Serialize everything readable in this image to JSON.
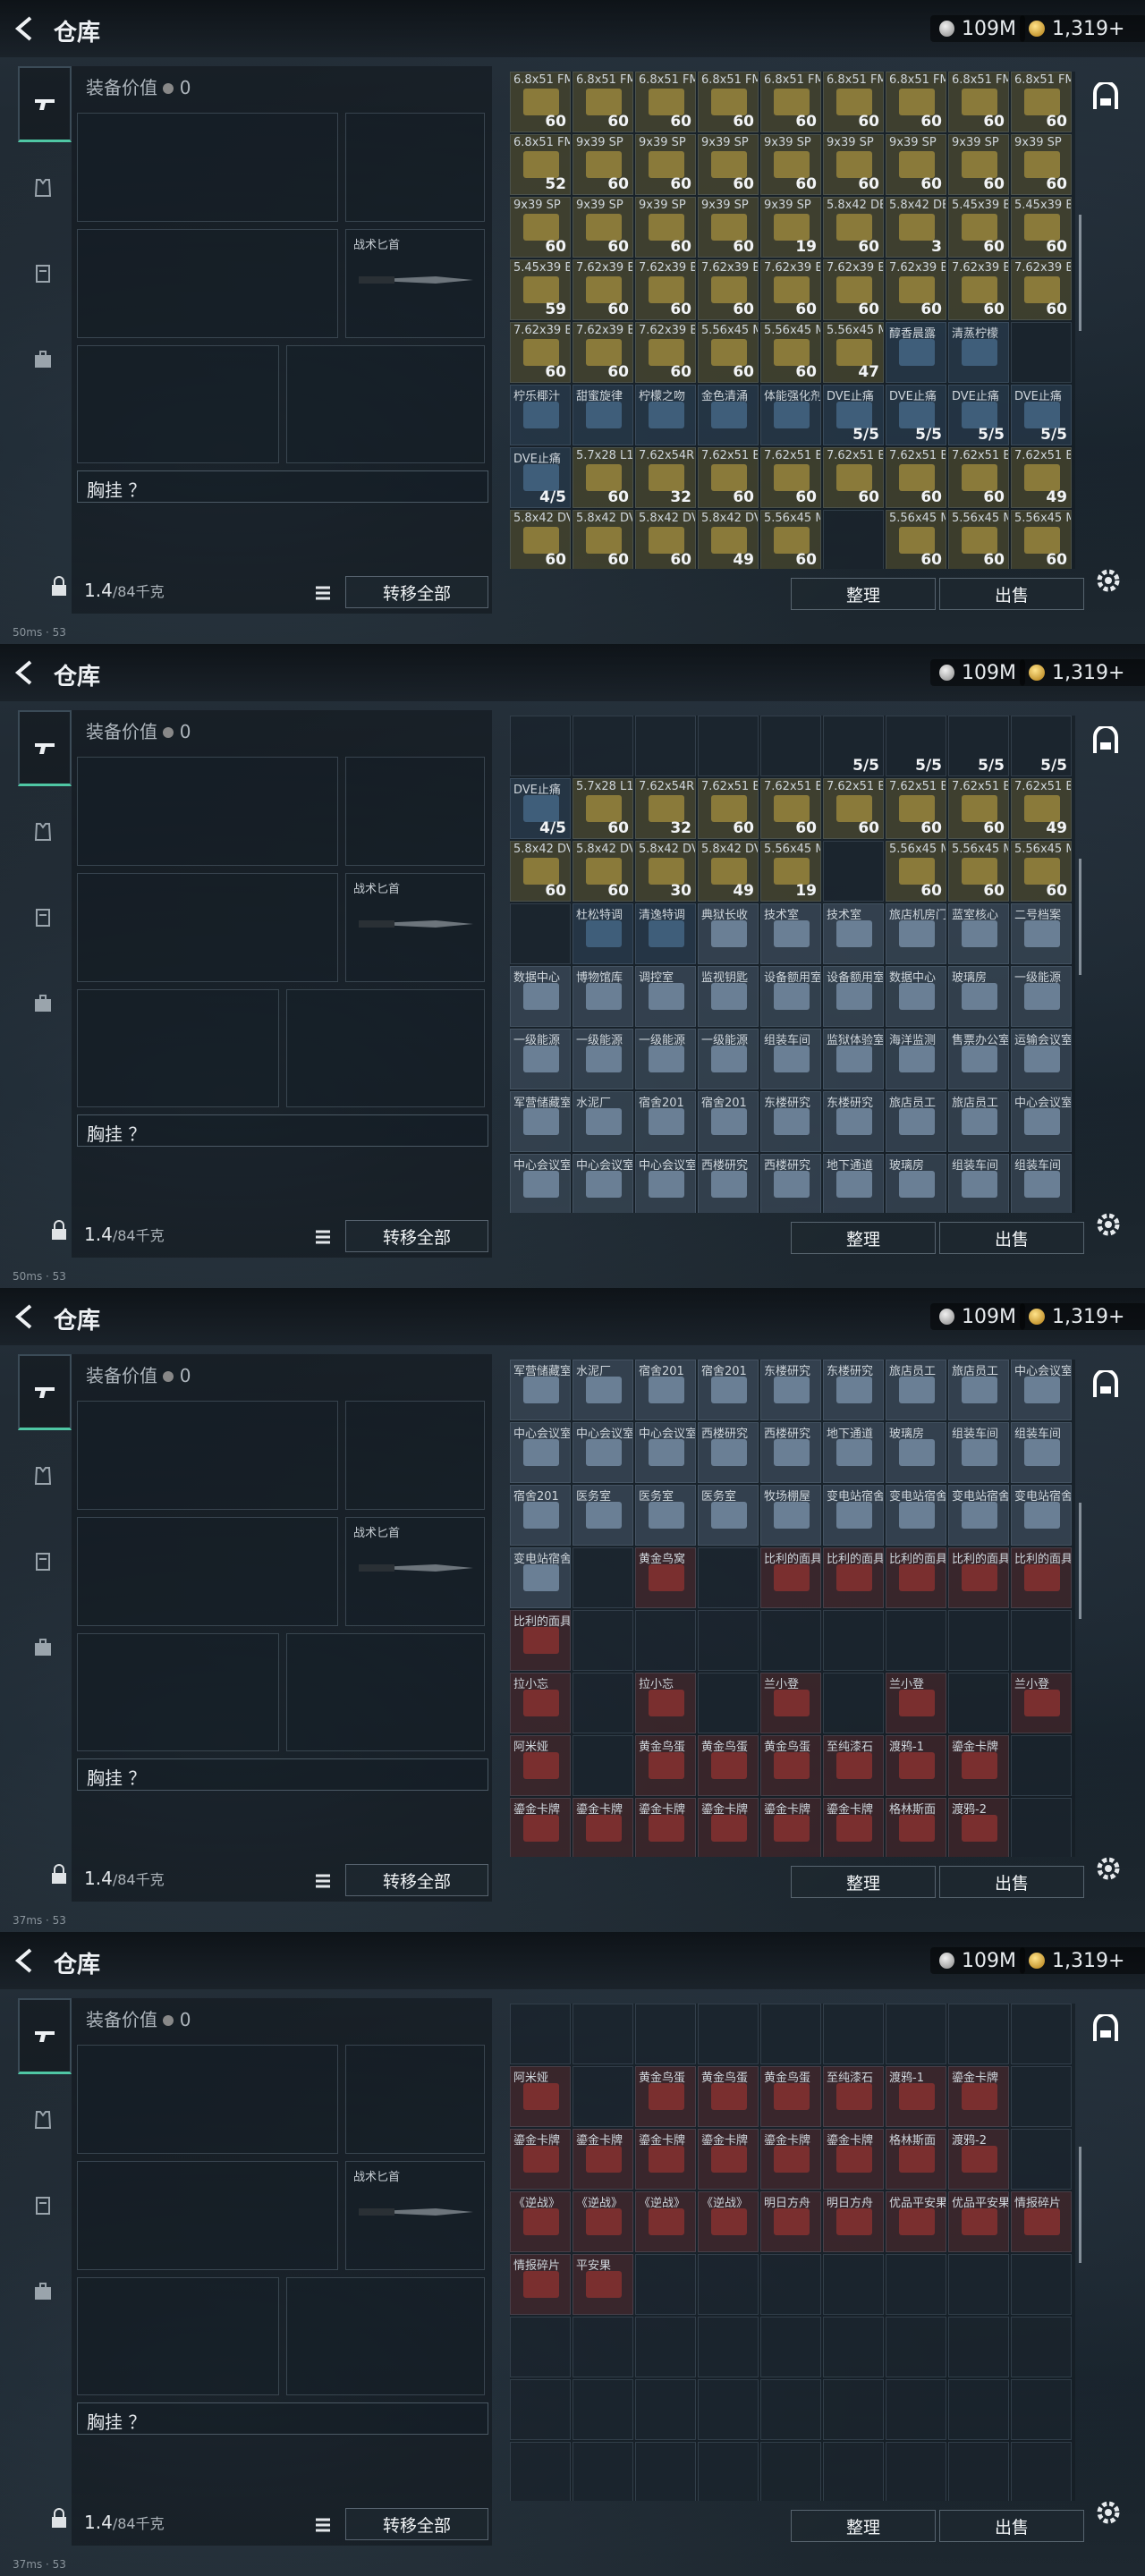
{
  "topbar": {
    "title": "仓库",
    "silver": "109M",
    "gold": "1,319+"
  },
  "equip": {
    "value_label": "装备价值",
    "value": "0",
    "knife_label": "战术匕首",
    "chest_label": "胸挂 ？",
    "weight_current": "1.4",
    "weight_max": "/84千克",
    "transfer_label": "转移全部"
  },
  "actions": {
    "sort": "整理",
    "sell": "出售"
  },
  "status": {
    "ping": "50ms",
    "ping2": "37ms",
    "fps": "53"
  },
  "screens": [
    {
      "rows": [
        [
          [
            "6.8x51 FM",
            "60"
          ],
          [
            "6.8x51 FM",
            "60"
          ],
          [
            "6.8x51 FM",
            "60"
          ],
          [
            "6.8x51 FM",
            "60"
          ],
          [
            "6.8x51 FM",
            "60"
          ],
          [
            "6.8x51 FM",
            "60"
          ],
          [
            "6.8x51 FM",
            "60"
          ],
          [
            "6.8x51 FM",
            "60"
          ],
          [
            "6.8x51 FM",
            "60"
          ]
        ],
        [
          [
            "6.8x51 FM",
            "52"
          ],
          [
            "9x39 SP",
            "60"
          ],
          [
            "9x39 SP",
            "60"
          ],
          [
            "9x39 SP",
            "60"
          ],
          [
            "9x39 SP",
            "60"
          ],
          [
            "9x39 SP",
            "60"
          ],
          [
            "9x39 SP",
            "60"
          ],
          [
            "9x39 SP",
            "60"
          ],
          [
            "9x39 SP",
            "60"
          ]
        ],
        [
          [
            "9x39 SP",
            "60"
          ],
          [
            "9x39 SP",
            "60"
          ],
          [
            "9x39 SP",
            "60"
          ],
          [
            "9x39 SP",
            "60"
          ],
          [
            "9x39 SP",
            "19"
          ],
          [
            "5.8x42 DBP",
            "60"
          ],
          [
            "5.8x42 DBP",
            "3"
          ],
          [
            "5.45x39 BP",
            "60"
          ],
          [
            "5.45x39 BP",
            "60"
          ]
        ],
        [
          [
            "5.45x39 BP",
            "59"
          ],
          [
            "7.62x39 BP",
            "60"
          ],
          [
            "7.62x39 BP",
            "60"
          ],
          [
            "7.62x39 BP",
            "60"
          ],
          [
            "7.62x39 BP",
            "60"
          ],
          [
            "7.62x39 BP",
            "60"
          ],
          [
            "7.62x39 BP",
            "60"
          ],
          [
            "7.62x39 BP",
            "60"
          ],
          [
            "7.62x39 BP",
            "60"
          ]
        ],
        [
          [
            "7.62x39 BP",
            "60"
          ],
          [
            "7.62x39 BP",
            "60"
          ],
          [
            "7.62x39 BP",
            "60"
          ],
          [
            "5.56x45 M855A1",
            "60"
          ],
          [
            "5.56x45 M855A1",
            "60"
          ],
          [
            "5.56x45 M855A1",
            "47"
          ],
          [
            "醇香晨露",
            ""
          ],
          [
            "清蒸柠檬",
            ""
          ],
          [
            "",
            ""
          ]
        ],
        [
          [
            "柠乐椰汁",
            ""
          ],
          [
            "甜蜜旋律",
            ""
          ],
          [
            "柠檬之吻",
            ""
          ],
          [
            "金色清涌",
            ""
          ],
          [
            "体能强化剂",
            ""
          ],
          [
            "DVE止痛",
            "5/5"
          ],
          [
            "DVE止痛",
            "5/5"
          ],
          [
            "DVE止痛",
            "5/5"
          ],
          [
            "DVE止痛",
            "5/5"
          ]
        ],
        [
          [
            "DVE止痛",
            "4/5"
          ],
          [
            "5.7x28 L191",
            "60"
          ],
          [
            "7.62x54R T46M",
            "32"
          ],
          [
            "7.62x51 BPZ",
            "60"
          ],
          [
            "7.62x51 BPZ",
            "60"
          ],
          [
            "7.62x51 BPZ",
            "60"
          ],
          [
            "7.62x51 BPZ",
            "60"
          ],
          [
            "7.62x51 BPZ",
            "60"
          ],
          [
            "7.62x51 BPZ",
            "49"
          ]
        ],
        [
          [
            "5.8x42 DVC88",
            "60"
          ],
          [
            "5.8x42 DVC88",
            "60"
          ],
          [
            "5.8x42 DVC88",
            "60"
          ],
          [
            "5.8x42 DVC88",
            "49"
          ],
          [
            "5.56x45 M855",
            "60"
          ],
          [
            "",
            ""
          ],
          [
            "5.56x45 M855",
            "60"
          ],
          [
            "5.56x45 M855",
            "60"
          ],
          [
            "5.56x45 M855",
            "60"
          ]
        ]
      ]
    },
    {
      "rows": [
        [
          [
            "",
            ""
          ],
          [
            "",
            ""
          ],
          [
            "",
            ""
          ],
          [
            "",
            ""
          ],
          [
            "",
            ""
          ],
          [
            "",
            "5/5"
          ],
          [
            "",
            "5/5"
          ],
          [
            "",
            "5/5"
          ],
          [
            "",
            "5/5"
          ]
        ],
        [
          [
            "DVE止痛",
            "4/5"
          ],
          [
            "5.7x28 L191",
            "60"
          ],
          [
            "7.62x54R T46M",
            "32"
          ],
          [
            "7.62x51 BPZ",
            "60"
          ],
          [
            "7.62x51 BPZ",
            "60"
          ],
          [
            "7.62x51 BPZ",
            "60"
          ],
          [
            "7.62x51 BPZ",
            "60"
          ],
          [
            "7.62x51 BPZ",
            "60"
          ],
          [
            "7.62x51 BPZ",
            "49"
          ]
        ],
        [
          [
            "5.8x42 DVC88",
            "60"
          ],
          [
            "5.8x42 DVC88",
            "60"
          ],
          [
            "5.8x42 DVC88",
            "30"
          ],
          [
            "5.8x42 DVC88",
            "49"
          ],
          [
            "5.56x45 M855",
            "19"
          ],
          [
            "",
            ""
          ],
          [
            "5.56x45 M855",
            "60"
          ],
          [
            "5.56x45 M855",
            "60"
          ],
          [
            "5.56x45 M855",
            "60"
          ]
        ],
        [
          [
            "",
            ""
          ],
          [
            "杜松特调",
            ""
          ],
          [
            "清逸特调",
            ""
          ],
          [
            "典狱长收",
            ""
          ],
          [
            "技术室",
            ""
          ],
          [
            "技术室",
            ""
          ],
          [
            "旅店机房门",
            ""
          ],
          [
            "蓝室核心",
            ""
          ],
          [
            "二号档案",
            ""
          ]
        ],
        [
          [
            "数据中心",
            ""
          ],
          [
            "博物馆库",
            ""
          ],
          [
            "调控室",
            ""
          ],
          [
            "监视钥匙",
            ""
          ],
          [
            "设备额用室",
            ""
          ],
          [
            "设备额用室",
            ""
          ],
          [
            "数据中心",
            ""
          ],
          [
            "玻璃房",
            ""
          ],
          [
            "一级能源",
            ""
          ]
        ],
        [
          [
            "一级能源",
            ""
          ],
          [
            "一级能源",
            ""
          ],
          [
            "一级能源",
            ""
          ],
          [
            "一级能源",
            ""
          ],
          [
            "组装车间",
            ""
          ],
          [
            "监狱体验室",
            ""
          ],
          [
            "海洋监测",
            ""
          ],
          [
            "售票办公室",
            ""
          ],
          [
            "运输会议室",
            ""
          ]
        ],
        [
          [
            "军营储藏室",
            ""
          ],
          [
            "水泥厂",
            ""
          ],
          [
            "宿舍201",
            ""
          ],
          [
            "宿舍201",
            ""
          ],
          [
            "东楼研究",
            ""
          ],
          [
            "东楼研究",
            ""
          ],
          [
            "旅店员工",
            ""
          ],
          [
            "旅店员工",
            ""
          ],
          [
            "中心会议室",
            ""
          ]
        ],
        [
          [
            "中心会议室",
            ""
          ],
          [
            "中心会议室",
            ""
          ],
          [
            "中心会议室",
            ""
          ],
          [
            "西楼研究",
            ""
          ],
          [
            "西楼研究",
            ""
          ],
          [
            "地下通道",
            ""
          ],
          [
            "玻璃房",
            ""
          ],
          [
            "组装车间",
            ""
          ],
          [
            "组装车间",
            ""
          ]
        ]
      ]
    },
    {
      "rows": [
        [
          [
            "军营储藏室",
            ""
          ],
          [
            "水泥厂",
            ""
          ],
          [
            "宿舍201",
            ""
          ],
          [
            "宿舍201",
            ""
          ],
          [
            "东楼研究",
            ""
          ],
          [
            "东楼研究",
            ""
          ],
          [
            "旅店员工",
            ""
          ],
          [
            "旅店员工",
            ""
          ],
          [
            "中心会议室",
            ""
          ]
        ],
        [
          [
            "中心会议室",
            ""
          ],
          [
            "中心会议室",
            ""
          ],
          [
            "中心会议室",
            ""
          ],
          [
            "西楼研究",
            ""
          ],
          [
            "西楼研究",
            ""
          ],
          [
            "地下通道",
            ""
          ],
          [
            "玻璃房",
            ""
          ],
          [
            "组装车间",
            ""
          ],
          [
            "组装车间",
            ""
          ]
        ],
        [
          [
            "宿舍201",
            ""
          ],
          [
            "医务室",
            ""
          ],
          [
            "医务室",
            ""
          ],
          [
            "医务室",
            ""
          ],
          [
            "牧场棚屋",
            ""
          ],
          [
            "变电站宿舍",
            ""
          ],
          [
            "变电站宿舍",
            ""
          ],
          [
            "变电站宿舍",
            ""
          ],
          [
            "变电站宿舍",
            ""
          ]
        ],
        [
          [
            "变电站宿舍",
            ""
          ],
          [
            "",
            ""
          ],
          [
            "黄金鸟窝",
            ""
          ],
          [
            "",
            ""
          ],
          [
            "比利的面具",
            ""
          ],
          [
            "比利的面具",
            ""
          ],
          [
            "比利的面具",
            ""
          ],
          [
            "比利的面具",
            ""
          ],
          [
            "比利的面具",
            ""
          ]
        ],
        [
          [
            "比利的面具",
            ""
          ],
          [
            "",
            ""
          ],
          [
            "",
            ""
          ],
          [
            "",
            ""
          ],
          [
            "",
            ""
          ],
          [
            "",
            ""
          ],
          [
            "",
            ""
          ],
          [
            "",
            ""
          ],
          [
            "",
            ""
          ]
        ],
        [
          [
            "拉小忘",
            ""
          ],
          [
            "",
            ""
          ],
          [
            "拉小忘",
            ""
          ],
          [
            "",
            ""
          ],
          [
            "兰小登",
            ""
          ],
          [
            "",
            ""
          ],
          [
            "兰小登",
            ""
          ],
          [
            "",
            ""
          ],
          [
            "兰小登",
            ""
          ]
        ],
        [
          [
            "阿米娅",
            ""
          ],
          [
            "",
            ""
          ],
          [
            "黄金鸟蛋",
            ""
          ],
          [
            "黄金鸟蛋",
            ""
          ],
          [
            "黄金鸟蛋",
            ""
          ],
          [
            "至纯漆石",
            ""
          ],
          [
            "渡鸦-1",
            ""
          ],
          [
            "鎏金卡牌",
            ""
          ],
          [
            "",
            ""
          ]
        ],
        [
          [
            "鎏金卡牌",
            ""
          ],
          [
            "鎏金卡牌",
            ""
          ],
          [
            "鎏金卡牌",
            ""
          ],
          [
            "鎏金卡牌",
            ""
          ],
          [
            "鎏金卡牌",
            ""
          ],
          [
            "鎏金卡牌",
            ""
          ],
          [
            "格林斯面",
            ""
          ],
          [
            "渡鸦-2",
            ""
          ],
          [
            "",
            ""
          ]
        ]
      ]
    },
    {
      "rows": [
        [
          [
            "",
            ""
          ],
          [
            "",
            ""
          ],
          [
            "",
            ""
          ],
          [
            "",
            ""
          ],
          [
            "",
            ""
          ],
          [
            "",
            ""
          ],
          [
            "",
            ""
          ],
          [
            "",
            ""
          ],
          [
            "",
            ""
          ]
        ],
        [
          [
            "阿米娅",
            ""
          ],
          [
            "",
            ""
          ],
          [
            "黄金鸟蛋",
            ""
          ],
          [
            "黄金鸟蛋",
            ""
          ],
          [
            "黄金鸟蛋",
            ""
          ],
          [
            "至纯漆石",
            ""
          ],
          [
            "渡鸦-1",
            ""
          ],
          [
            "鎏金卡牌",
            ""
          ],
          [
            "",
            ""
          ]
        ],
        [
          [
            "鎏金卡牌",
            ""
          ],
          [
            "鎏金卡牌",
            ""
          ],
          [
            "鎏金卡牌",
            ""
          ],
          [
            "鎏金卡牌",
            ""
          ],
          [
            "鎏金卡牌",
            ""
          ],
          [
            "鎏金卡牌",
            ""
          ],
          [
            "格林斯面",
            ""
          ],
          [
            "渡鸦-2",
            ""
          ],
          [
            "",
            ""
          ]
        ],
        [
          [
            "《逆战》",
            ""
          ],
          [
            "《逆战》",
            ""
          ],
          [
            "《逆战》",
            ""
          ],
          [
            "《逆战》",
            ""
          ],
          [
            "明日方舟",
            ""
          ],
          [
            "明日方舟",
            ""
          ],
          [
            "优品平安果",
            ""
          ],
          [
            "优品平安果",
            ""
          ],
          [
            "情报碎片",
            ""
          ]
        ],
        [
          [
            "情报碎片",
            ""
          ],
          [
            "平安果",
            ""
          ],
          [
            "",
            ""
          ],
          [
            "",
            ""
          ],
          [
            "",
            ""
          ],
          [
            "",
            ""
          ],
          [
            "",
            ""
          ],
          [
            "",
            ""
          ],
          [
            "",
            ""
          ]
        ],
        [
          [
            "",
            ""
          ],
          [
            "",
            ""
          ],
          [
            "",
            ""
          ],
          [
            "",
            ""
          ],
          [
            "",
            ""
          ],
          [
            "",
            ""
          ],
          [
            "",
            ""
          ],
          [
            "",
            ""
          ],
          [
            "",
            ""
          ]
        ],
        [
          [
            "",
            ""
          ],
          [
            "",
            ""
          ],
          [
            "",
            ""
          ],
          [
            "",
            ""
          ],
          [
            "",
            ""
          ],
          [
            "",
            ""
          ],
          [
            "",
            ""
          ],
          [
            "",
            ""
          ],
          [
            "",
            ""
          ]
        ],
        [
          [
            "",
            ""
          ],
          [
            "",
            ""
          ],
          [
            "",
            ""
          ],
          [
            "",
            ""
          ],
          [
            "",
            ""
          ],
          [
            "",
            ""
          ],
          [
            "",
            ""
          ],
          [
            "",
            ""
          ],
          [
            "",
            ""
          ]
        ]
      ]
    }
  ],
  "colors": {
    "accent": "#4fc7a4",
    "ammo": "#8a7a3a",
    "key": "#6a7f95",
    "rare": "#7a2f2f",
    "med": "#3f5e7a"
  }
}
